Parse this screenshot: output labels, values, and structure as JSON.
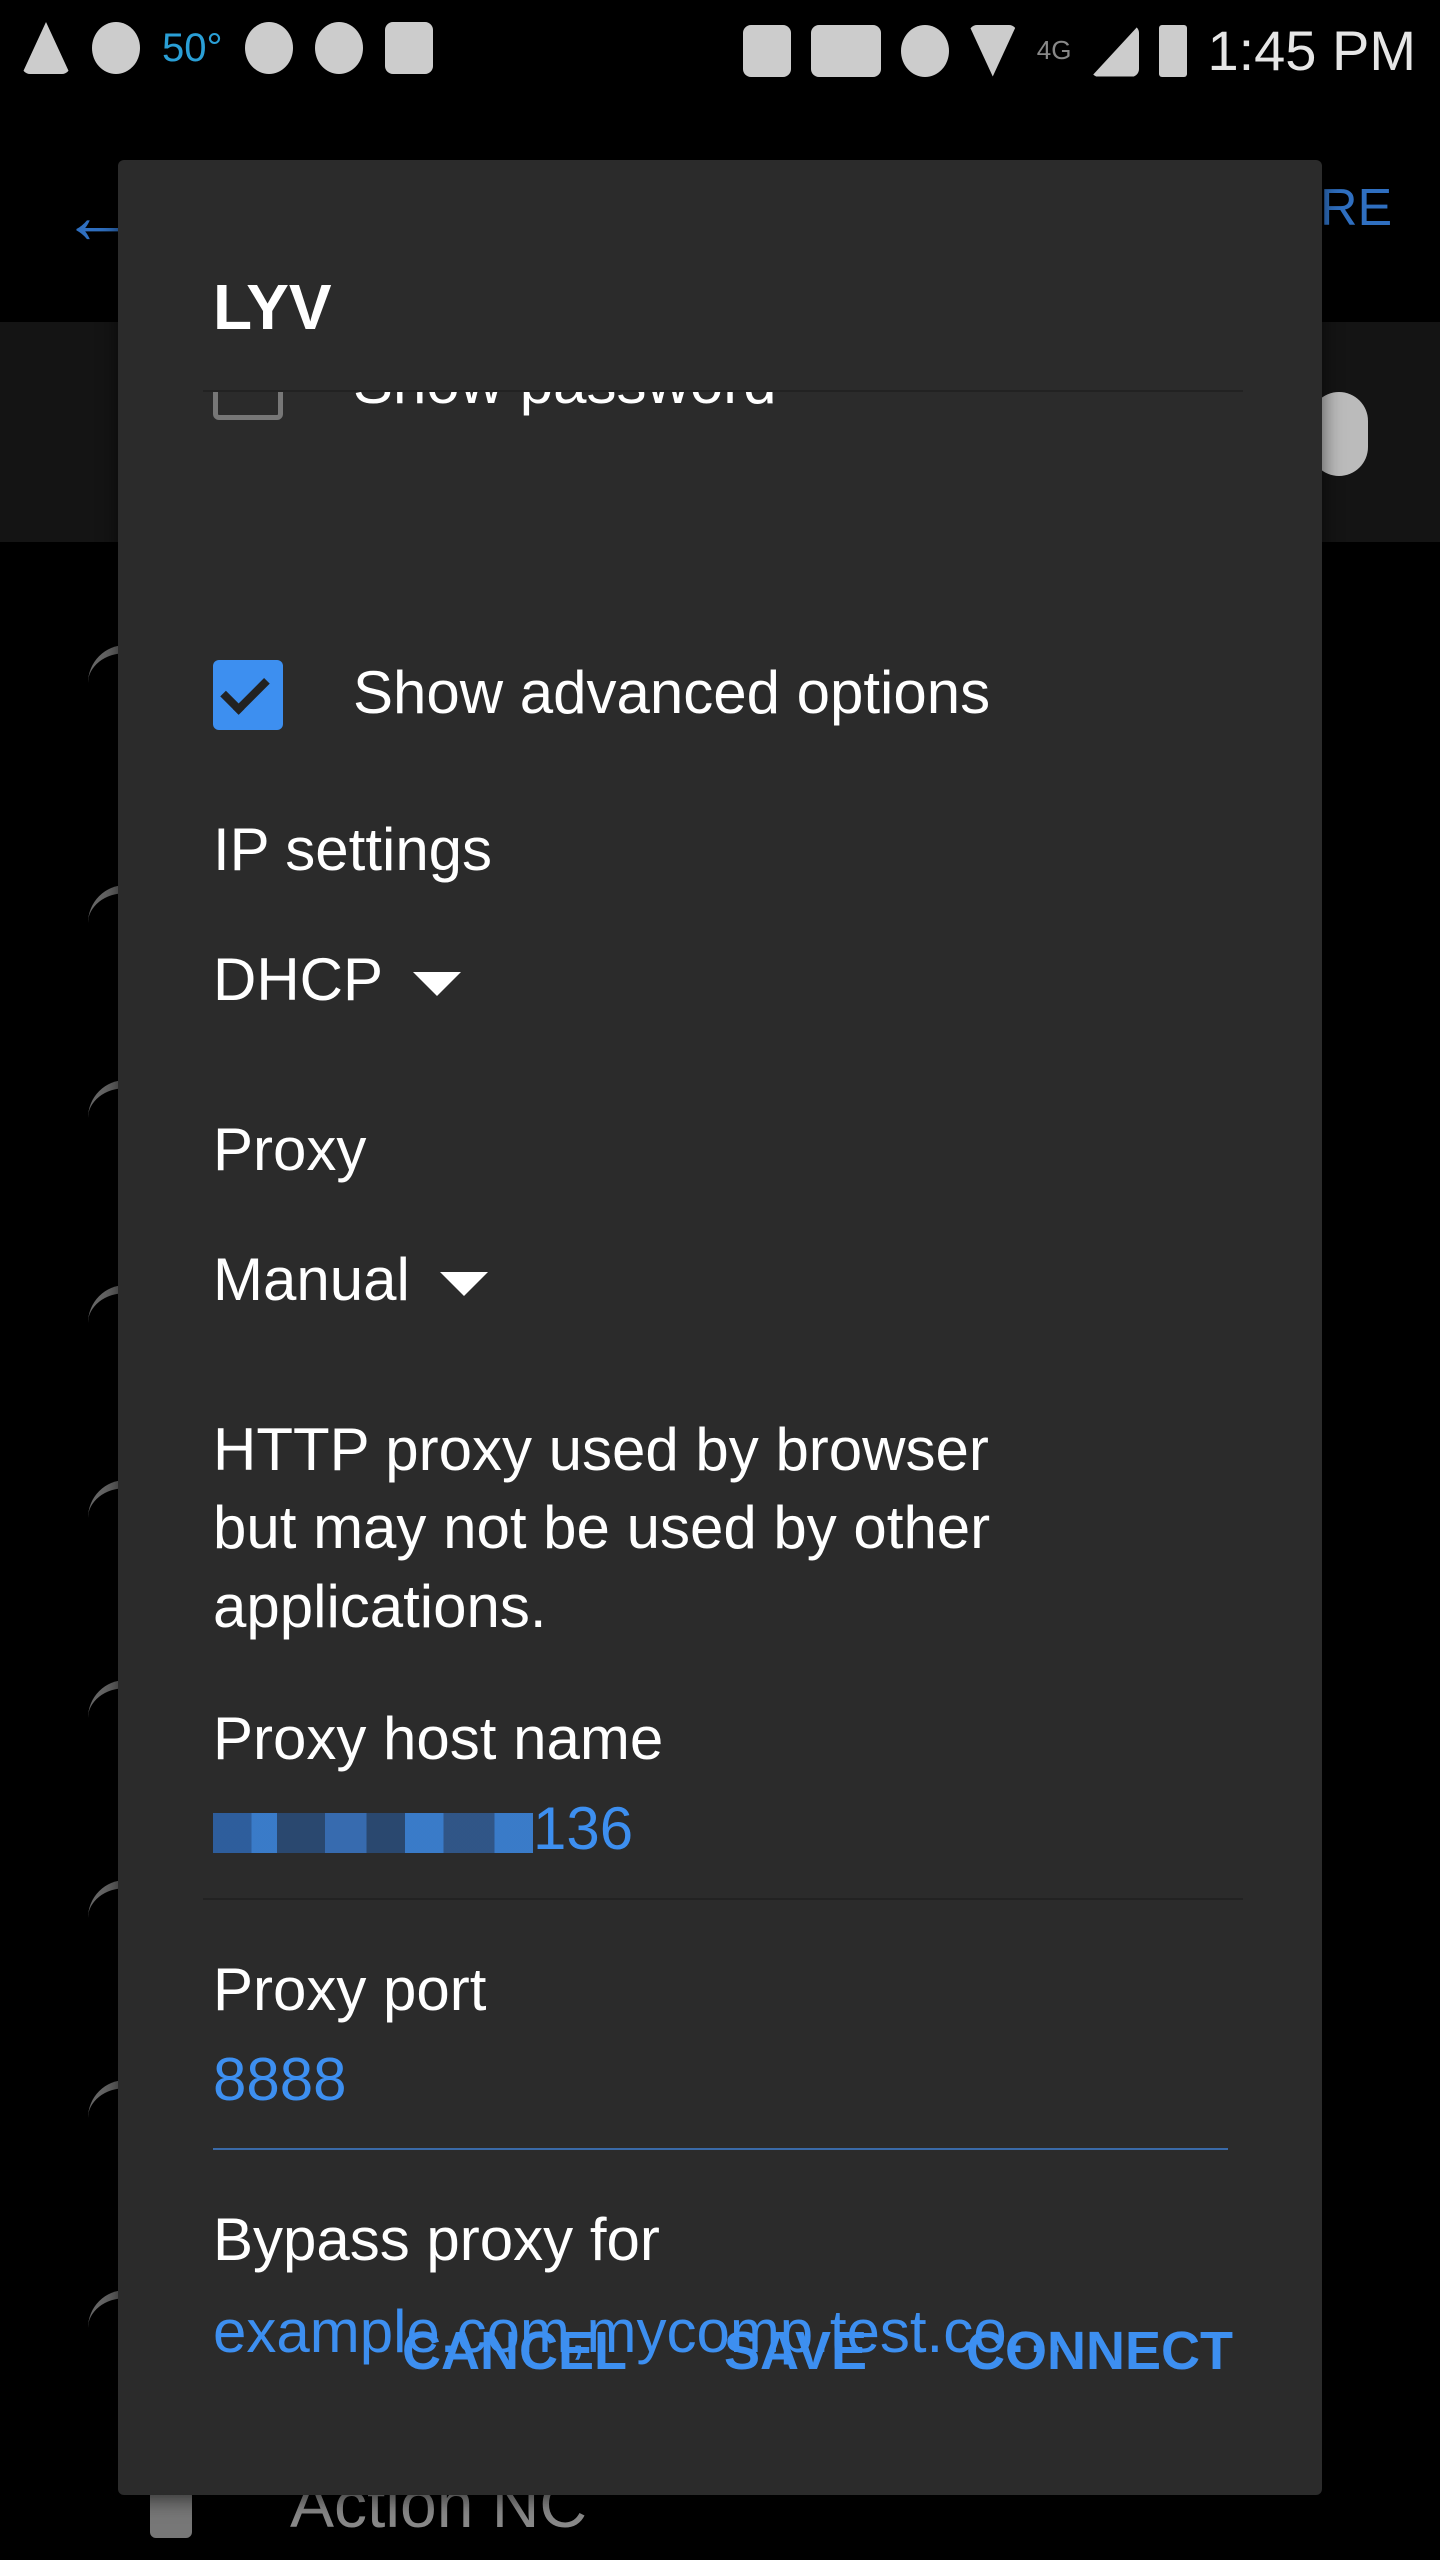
{
  "status_bar": {
    "temperature": "50°",
    "time": "1:45 PM",
    "network": "4G",
    "left_icons": [
      "warning-icon",
      "slack-icon",
      "pinterest-icon",
      "weather-bug-icon",
      "maps-icon"
    ],
    "right_icons": [
      "nfc-icon",
      "vibrate-icon",
      "alarm-icon",
      "wifi-icon",
      "signal-icon",
      "battery-charging-icon"
    ]
  },
  "background": {
    "right_action_partial": "RE",
    "list_item_partial": "Action NC"
  },
  "dialog": {
    "title": "LYV",
    "show_password_label": "Show password",
    "show_password_checked": false,
    "show_advanced_label": "Show advanced options",
    "show_advanced_checked": true,
    "ip_settings_label": "IP settings",
    "ip_settings_value": "DHCP",
    "proxy_label": "Proxy",
    "proxy_value": "Manual",
    "proxy_note": [
      "HTTP proxy used by browser",
      "but may not be used by other",
      "applications."
    ],
    "proxy_host_label": "Proxy host name",
    "proxy_host_value_visible": "136",
    "proxy_port_label": "Proxy port",
    "proxy_port_value": "8888",
    "bypass_label": "Bypass proxy for",
    "bypass_value": "example.com,mycomp.test.co…",
    "buttons": {
      "cancel": "CANCEL",
      "save": "SAVE",
      "connect": "CONNECT"
    },
    "accent_color": "#3d8ff0"
  }
}
